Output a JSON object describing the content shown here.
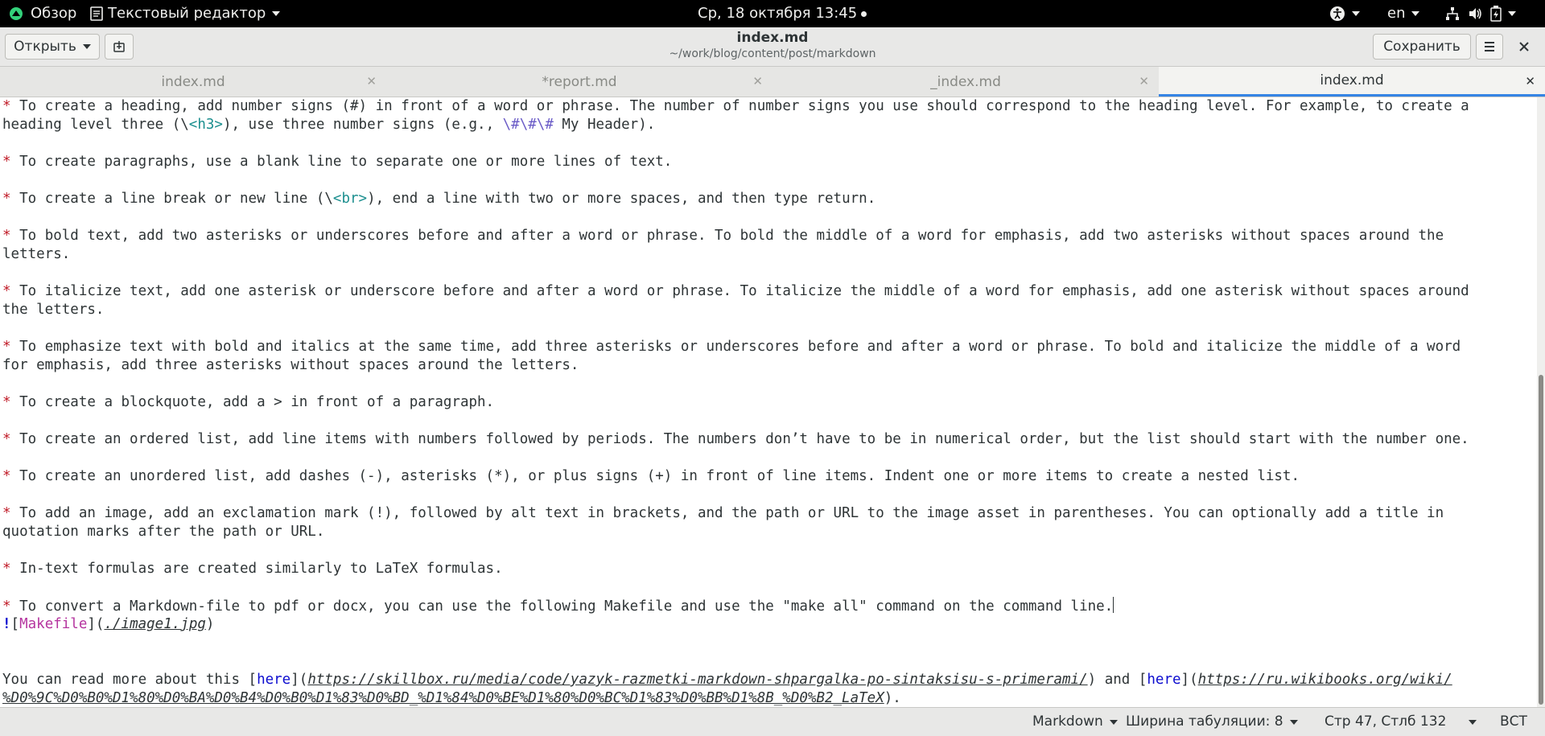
{
  "topbar": {
    "overview": "Обзор",
    "app_menu": "Текстовый редактор",
    "clock": "Ср, 18 октября  13:45",
    "language": "en"
  },
  "header": {
    "open_label": "Открыть",
    "title": "index.md",
    "path": "~/work/blog/content/post/markdown",
    "save_label": "Сохранить"
  },
  "tabs": [
    {
      "label": "index.md"
    },
    {
      "label": "*report.md"
    },
    {
      "label": "_index.md"
    },
    {
      "label": "index.md"
    }
  ],
  "editor": {
    "l1": {
      "b": "*",
      "t": " To create a heading, add number signs (#) in front of a word or phrase. The number of number signs you use should correspond to the heading level. For example, to create a"
    },
    "l2": {
      "a": "heading level three (\\",
      "tag": "<h3>",
      "b": "), use three number signs (e.g., ",
      "esc": "\\#\\#\\#",
      "c": " My Header)."
    },
    "l3": {
      "b": "*",
      "t": " To create paragraphs, use a blank line to separate one or more lines of text."
    },
    "l4": {
      "b": "*",
      "a": " To create a line break or new line (\\",
      "tag": "<br>",
      "c": "), end a line with two or more spaces, and then type return."
    },
    "l5": {
      "b": "*",
      "t": " To bold text, add two asterisks or underscores before and after a word or phrase. To bold the middle of a word for emphasis, add two asterisks without spaces around the"
    },
    "l6": {
      "t": "letters."
    },
    "l7": {
      "b": "*",
      "t": " To italicize text, add one asterisk or underscore before and after a word or phrase. To italicize the middle of a word for emphasis, add one asterisk without spaces around"
    },
    "l8": {
      "t": "the letters."
    },
    "l9": {
      "b": "*",
      "t": " To emphasize text with bold and italics at the same time, add three asterisks or underscores before and after a word or phrase. To bold and italicize the middle of a word"
    },
    "l10": {
      "t": "for emphasis, add three asterisks without spaces around the letters."
    },
    "l11": {
      "b": "*",
      "t": " To create a blockquote, add a > in front of a paragraph."
    },
    "l12": {
      "b": "*",
      "t": " To create an ordered list, add line items with numbers followed by periods. The numbers don’t have to be in numerical order, but the list should start with the number one."
    },
    "l13": {
      "b": "*",
      "t": " To create an unordered list, add dashes (-), asterisks (*), or plus signs (+) in front of line items. Indent one or more items to create a nested list."
    },
    "l14": {
      "b": "*",
      "t": " To add an image, add an exclamation mark (!), followed by alt text in brackets, and the path or URL to the image asset in parentheses. You can optionally add a title in"
    },
    "l15": {
      "t": "quotation marks after the path or URL."
    },
    "l16": {
      "b": "*",
      "t": " In-text formulas are created similarly to LaTeX formulas."
    },
    "l17": {
      "b": "*",
      "t": " To convert a Markdown-file to pdf or docx, you can use the following Makefile and use the \"make all\" command on the command line."
    },
    "l18": {
      "bang": "!",
      "ob": "[",
      "label": "Makefile",
      "mid": "](",
      "url": "./image1.jpg",
      "cb": ")"
    },
    "l19": {
      "a": "You can read more about this [",
      "here1": "here",
      "b": "](",
      "url1": "https://skillbox.ru/media/code/yazyk-razmetki-markdown-shpargalka-po-sintaksisu-s-primerami/",
      "c": ") and [",
      "here2": "here",
      "d": "](",
      "url2a": "https://ru.wikibooks.org/wiki/"
    },
    "l20": {
      "url2b": "%D0%9C%D0%B0%D1%80%D0%BA%D0%B4%D0%B0%D1%83%D0%BD_%D1%84%D0%BE%D1%80%D0%BC%D1%83%D0%BB%D1%8B_%D0%B2_LaTeX",
      "e": ")."
    }
  },
  "status": {
    "language": "Markdown",
    "tab_width": "Ширина табуляции: 8",
    "position": "Стр 47, Стлб 132",
    "mode": "ВСТ"
  },
  "colors": {
    "accent": "#3584e4",
    "bullet": "#c01c28",
    "tag": "#1c8f8f",
    "link_label": "#b5359f",
    "link_text": "#0d0dcf"
  }
}
